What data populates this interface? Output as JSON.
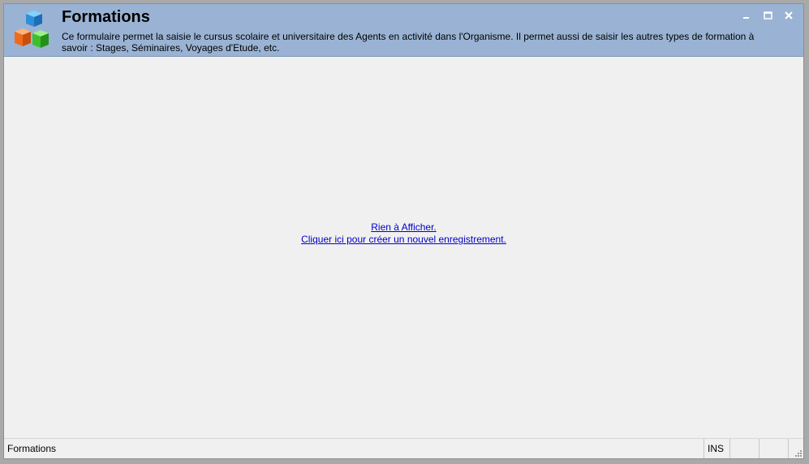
{
  "window": {
    "title": "Formations",
    "description": "Ce formulaire permet la saisie le cursus scolaire et universitaire des Agents en activité dans l'Organisme. Il permet aussi de saisir les autres types de formation à savoir : Stages, Séminaires, Voyages d'Etude, etc.",
    "icon": "cubes-icon",
    "controls": [
      "minimize-icon",
      "maximize-icon",
      "close-icon"
    ]
  },
  "content": {
    "empty_text": "Rien à Afficher.",
    "create_link": "Cliquer ici pour créer un nouvel enregistrement."
  },
  "statusbar": {
    "left_text": "Formations",
    "ins_indicator": "INS"
  },
  "colors": {
    "header_bg": "#9ab3d4",
    "body_bg": "#f0f0f0",
    "link": "#0000cc"
  }
}
